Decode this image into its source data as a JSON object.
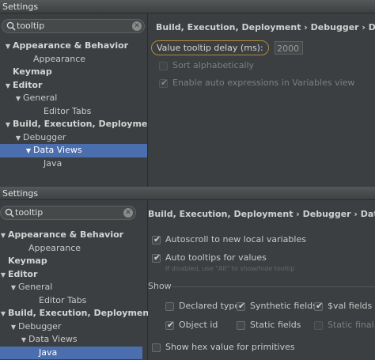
{
  "window1": {
    "title": "Settings",
    "search": {
      "value": "tooltip"
    },
    "tree": [
      {
        "label": "Appearance & Behavior",
        "arrow": "▼",
        "level": 0,
        "bold": true
      },
      {
        "label": "Appearance",
        "arrow": "",
        "level": 2,
        "bold": false
      },
      {
        "label": "Keymap",
        "arrow": "",
        "level": 0,
        "bold": true
      },
      {
        "label": "Editor",
        "arrow": "▼",
        "level": 0,
        "bold": true
      },
      {
        "label": "General",
        "arrow": "▼",
        "level": 1,
        "bold": false
      },
      {
        "label": "Editor Tabs",
        "arrow": "",
        "level": 3,
        "bold": false
      },
      {
        "label": "Build, Execution, Deployment",
        "arrow": "▼",
        "level": 0,
        "bold": true
      },
      {
        "label": "Debugger",
        "arrow": "▼",
        "level": 1,
        "bold": false
      },
      {
        "label": "Data Views",
        "arrow": "▼",
        "level": 2,
        "bold": false,
        "selected": true
      },
      {
        "label": "Java",
        "arrow": "",
        "level": 3,
        "bold": false
      }
    ],
    "breadcrumb": "Build, Execution, Deployment › Debugger › Data Views",
    "delay_label": "Value tooltip delay (ms):",
    "delay_value": "2000",
    "sort_label": "Sort alphabetically",
    "auto_expr_label": "Enable auto expressions in Variables view"
  },
  "window2": {
    "title": "Settings",
    "search": {
      "value": "tooltip"
    },
    "tree": [
      {
        "label": "Appearance & Behavior",
        "arrow": "▼",
        "level": 0,
        "bold": true
      },
      {
        "label": "Appearance",
        "arrow": "",
        "level": 2,
        "bold": false
      },
      {
        "label": "Keymap",
        "arrow": "",
        "level": 0,
        "bold": true
      },
      {
        "label": "Editor",
        "arrow": "▼",
        "level": 0,
        "bold": true
      },
      {
        "label": "General",
        "arrow": "▼",
        "level": 1,
        "bold": false
      },
      {
        "label": "Editor Tabs",
        "arrow": "",
        "level": 3,
        "bold": false
      },
      {
        "label": "Build, Execution, Deployment",
        "arrow": "▼",
        "level": 0,
        "bold": true
      },
      {
        "label": "Debugger",
        "arrow": "▼",
        "level": 1,
        "bold": false
      },
      {
        "label": "Data Views",
        "arrow": "▼",
        "level": 2,
        "bold": false
      },
      {
        "label": "Java",
        "arrow": "",
        "level": 3,
        "bold": false,
        "selected": true
      }
    ],
    "breadcrumb": "Build, Execution, Deployment › Debugger › Data Views › Java",
    "autoscroll_label": "Autoscroll to new local variables",
    "auto_tooltips_label": "Auto tooltips for values",
    "auto_tooltips_hint": "If disabled, use \"Alt\" to show/hide tooltip",
    "show_section": "Show",
    "declared_type": "Declared type",
    "synthetic_fields": "Synthetic fields",
    "val_fields": "$val fields as",
    "object_id": "Object id",
    "static_fields": "Static fields",
    "static_final": "Static final fie",
    "hex_label": "Show hex value for primitives"
  }
}
